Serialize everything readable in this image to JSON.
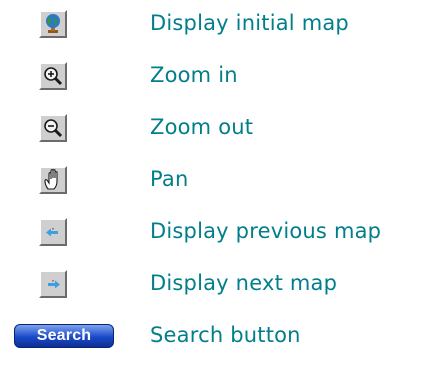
{
  "legend": {
    "items": [
      {
        "icon": "globe-icon",
        "label": "Display initial map"
      },
      {
        "icon": "zoom-in-icon",
        "label": "Zoom in"
      },
      {
        "icon": "zoom-out-icon",
        "label": "Zoom out"
      },
      {
        "icon": "pan-hand-icon",
        "label": "Pan"
      },
      {
        "icon": "previous-map-arrow-icon",
        "label": "Display previous map"
      },
      {
        "icon": "next-map-arrow-icon",
        "label": "Display next map"
      }
    ],
    "search": {
      "button_label": "Search",
      "label": "Search button"
    }
  },
  "colors": {
    "label_text": "#007f8a",
    "tool_face": "#cfcfcf",
    "search_blue": "#1a49c9",
    "arrow": "#3aa0e0"
  }
}
